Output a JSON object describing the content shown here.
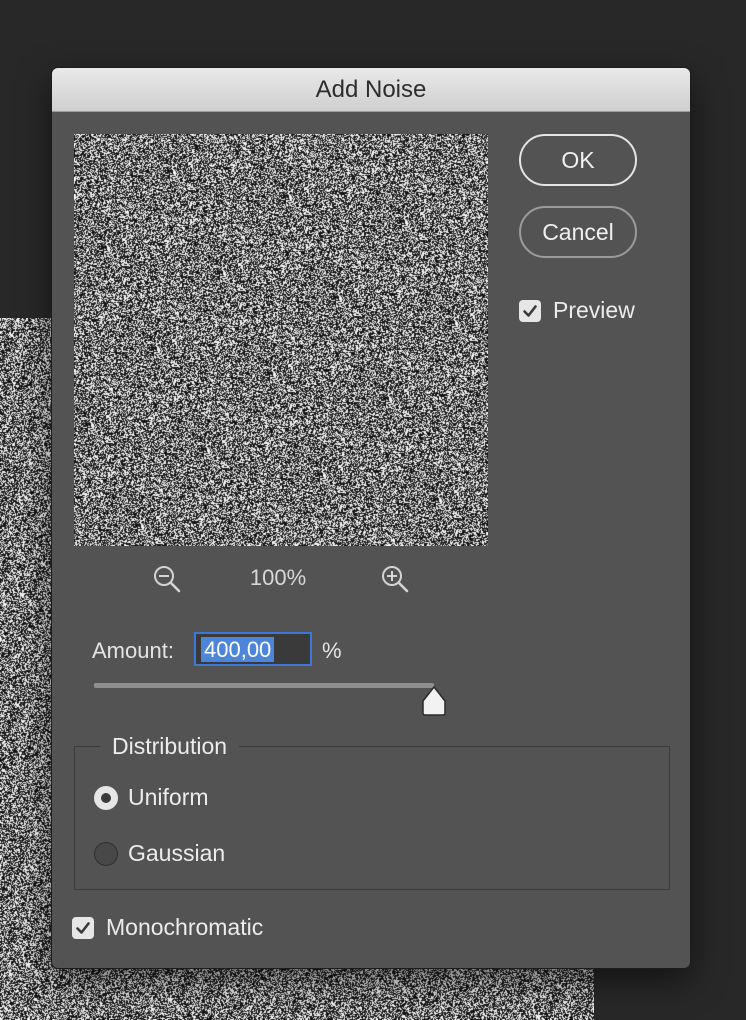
{
  "dialog": {
    "title": "Add Noise",
    "ok_label": "OK",
    "cancel_label": "Cancel",
    "preview_label": "Preview",
    "preview_checked": true
  },
  "zoom": {
    "zoom_out_icon": "zoom-out-icon",
    "zoom_in_icon": "zoom-in-icon",
    "level": "100%"
  },
  "amount": {
    "label": "Amount:",
    "value": "400,00",
    "unit": "%",
    "slider_fraction": 1.0
  },
  "distribution": {
    "title": "Distribution",
    "options": [
      {
        "label": "Uniform",
        "selected": true
      },
      {
        "label": "Gaussian",
        "selected": false
      }
    ]
  },
  "monochromatic": {
    "label": "Monochromatic",
    "checked": true
  },
  "colors": {
    "dialog_bg": "#535353",
    "accent": "#3c79d6",
    "selection": "#4d86d8"
  }
}
